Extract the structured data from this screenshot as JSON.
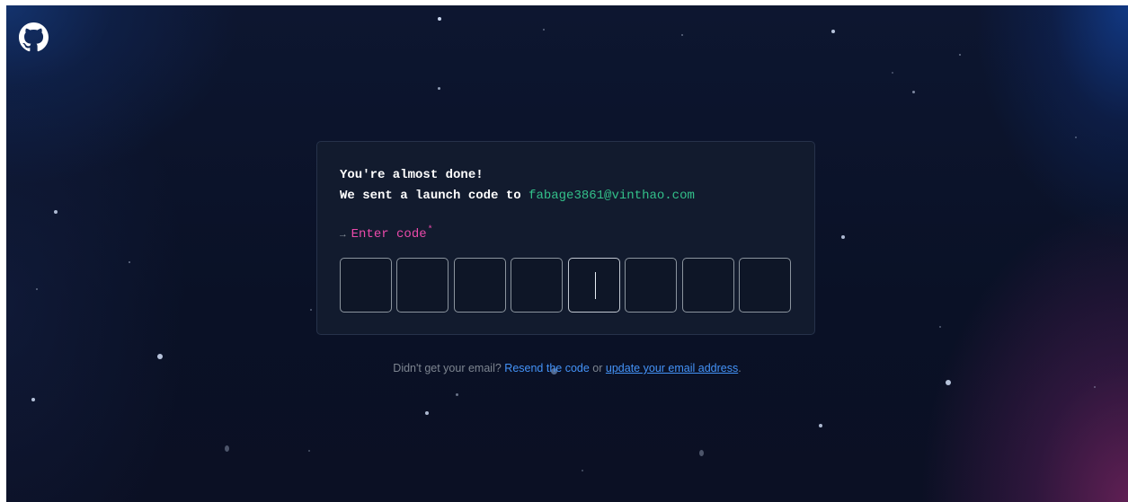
{
  "brand": {
    "logo_icon": "github-mark-icon"
  },
  "card": {
    "heading": "You're almost done!",
    "sent_text": "We sent a launch code to",
    "email": "fabage3861@vinthao.com",
    "enter_arrow": "→",
    "enter_label": "Enter code",
    "required_mark": "*",
    "code_digits": [
      "",
      "",
      "",
      "",
      "",
      "",
      "",
      ""
    ],
    "active_box_index": 4
  },
  "footer": {
    "prefix": "Didn't get your email?",
    "resend_link": "Resend the code",
    "middle": "or",
    "update_link": "update your email address",
    "suffix": "."
  },
  "colors": {
    "background": "#0b1226",
    "card_background": "#121b2e",
    "email_green": "#33c08a",
    "label_pink": "#ea4aaa",
    "link_blue": "#4493f8",
    "muted_text": "#7d8590"
  }
}
